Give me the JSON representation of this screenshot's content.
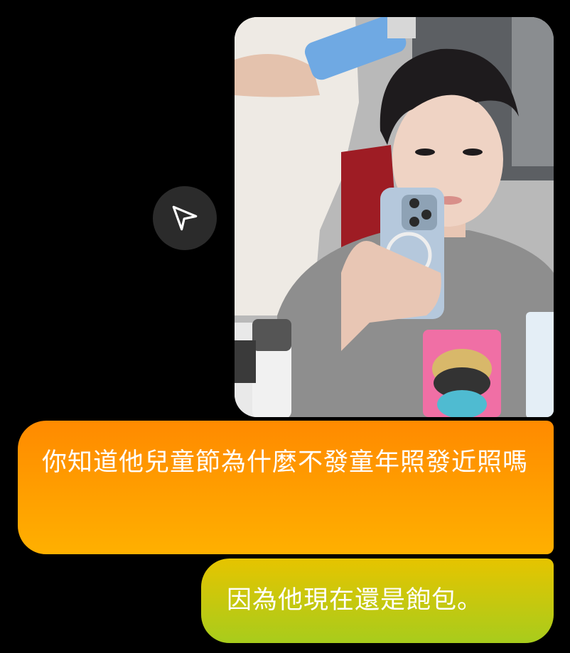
{
  "chat": {
    "messages": [
      {
        "type": "image",
        "description_icon": "photo-message",
        "share_icon": "send-icon"
      },
      {
        "type": "text",
        "text": "你知道他兒童節為什麼不發童年照發近照嗎",
        "color": "#ffffff",
        "gradient": [
          "#ff8a00",
          "#ffb000"
        ]
      },
      {
        "type": "text",
        "text": "因為他現在還是飽包。",
        "color": "#ffffff",
        "gradient": [
          "#e6c400",
          "#a8cc1c"
        ]
      }
    ]
  },
  "colors": {
    "background": "#000000",
    "share_button_bg": "#2b2b2b"
  }
}
